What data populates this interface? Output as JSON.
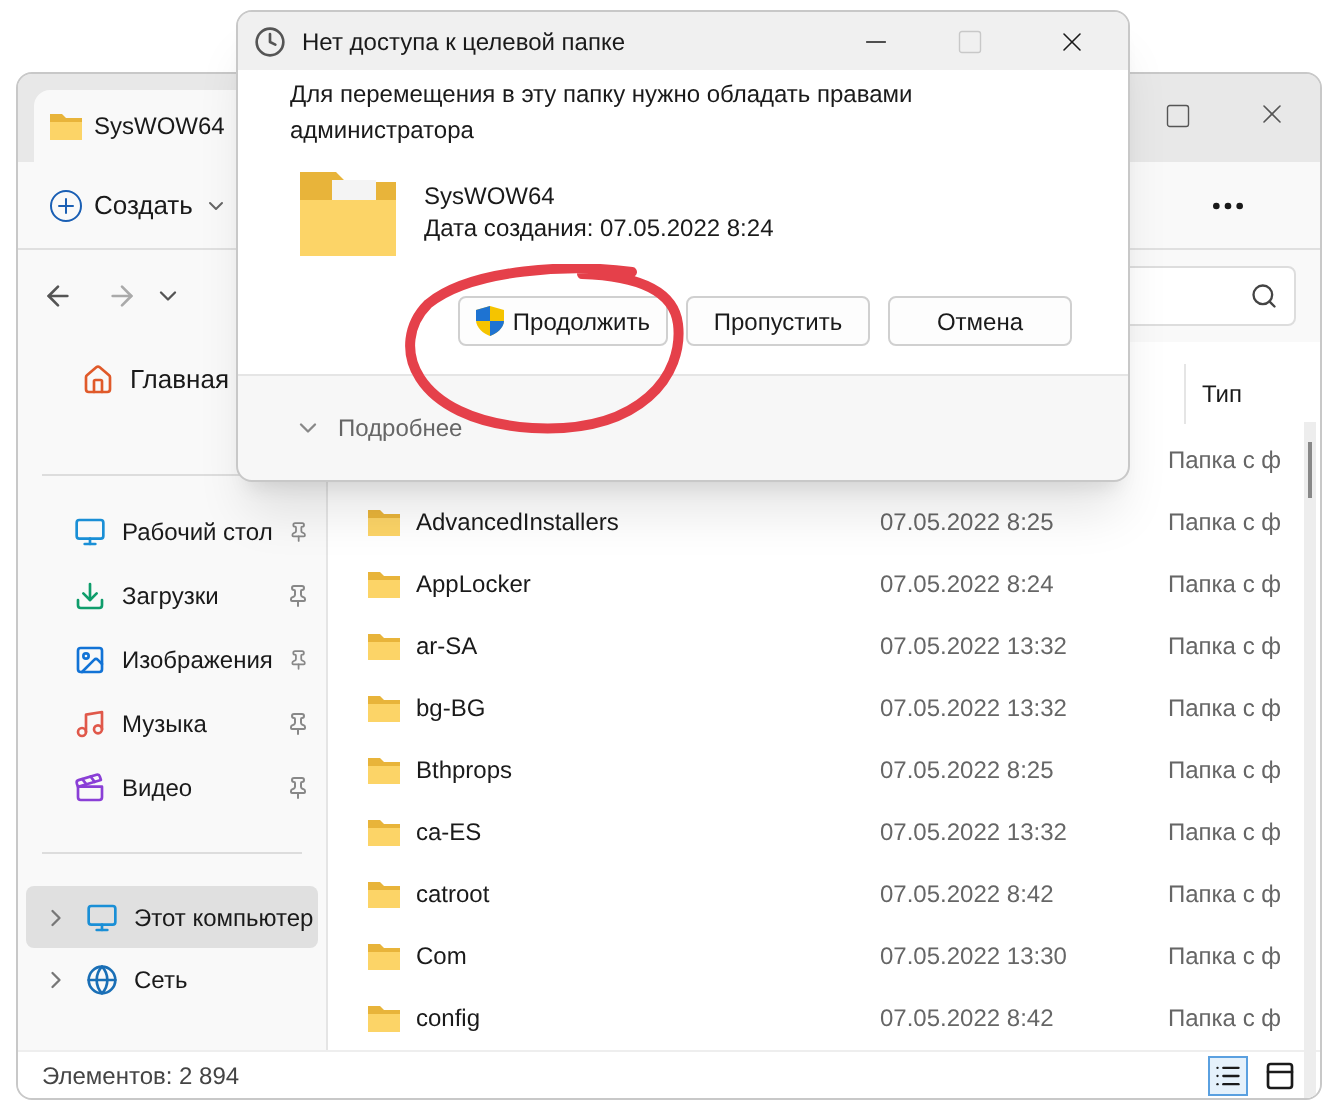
{
  "explorer": {
    "tab": "SysWOW64",
    "new_label": "Создать",
    "home": "Главная",
    "quick_access": [
      {
        "label": "Рабочий стол",
        "kind": "desktop",
        "pinned": true
      },
      {
        "label": "Загрузки",
        "kind": "downloads",
        "pinned": true
      },
      {
        "label": "Изображения",
        "kind": "pictures",
        "pinned": true
      },
      {
        "label": "Музыка",
        "kind": "music",
        "pinned": true
      },
      {
        "label": "Видео",
        "kind": "videos",
        "pinned": true
      }
    ],
    "locations": [
      {
        "label": "Этот компьютер",
        "kind": "computer",
        "selected": true
      },
      {
        "label": "Сеть",
        "kind": "network",
        "selected": false
      }
    ],
    "column_header": "Тип",
    "rows": [
      {
        "type": "Папка с ф"
      },
      {
        "name": "AdvancedInstallers",
        "date": "07.05.2022 8:25",
        "type": "Папка с ф"
      },
      {
        "name": "AppLocker",
        "date": "07.05.2022 8:24",
        "type": "Папка с ф"
      },
      {
        "name": "ar-SA",
        "date": "07.05.2022 13:32",
        "type": "Папка с ф"
      },
      {
        "name": "bg-BG",
        "date": "07.05.2022 13:32",
        "type": "Папка с ф"
      },
      {
        "name": "Bthprops",
        "date": "07.05.2022 8:25",
        "type": "Папка с ф"
      },
      {
        "name": "ca-ES",
        "date": "07.05.2022 13:32",
        "type": "Папка с ф"
      },
      {
        "name": "catroot",
        "date": "07.05.2022 8:42",
        "type": "Папка с ф"
      },
      {
        "name": "Com",
        "date": "07.05.2022 13:30",
        "type": "Папка с ф"
      },
      {
        "name": "config",
        "date": "07.05.2022 8:42",
        "type": "Папка с ф"
      }
    ],
    "status": "Элементов: 2 894"
  },
  "dialog": {
    "title": "Нет доступа к целевой папке",
    "maximize_disabled": true,
    "message": "Для перемещения в эту папку нужно обладать правами администратора",
    "item_name": "SysWOW64",
    "item_created": "Дата создания: 07.05.2022 8:24",
    "buttons": [
      {
        "label": "Продолжить",
        "kind": "admin"
      },
      {
        "label": "Пропустить",
        "kind": "plain"
      },
      {
        "label": "Отмена",
        "kind": "plain"
      }
    ],
    "details": "Подробнее"
  }
}
